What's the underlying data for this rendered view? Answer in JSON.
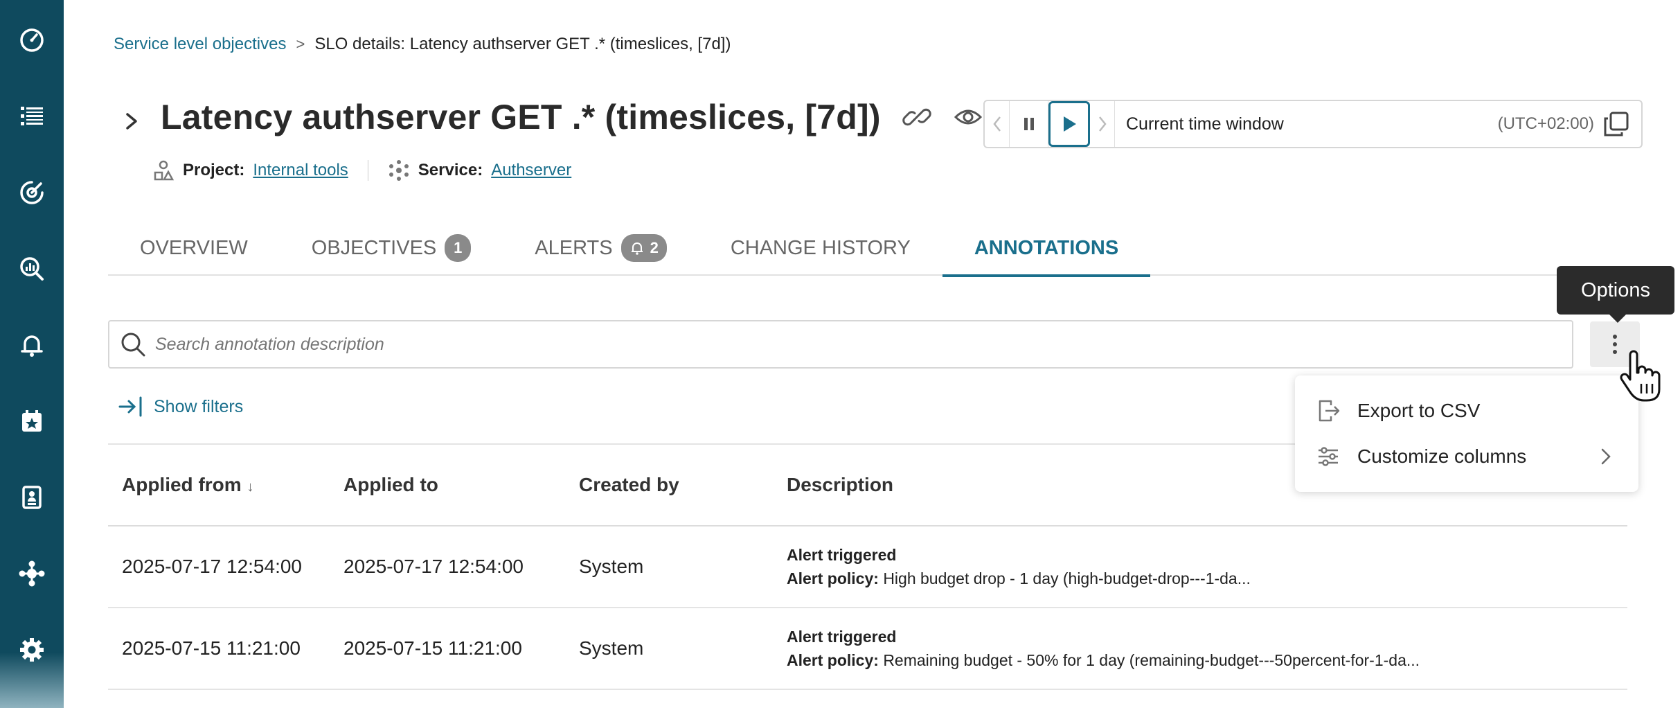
{
  "sidebar": {
    "icons": [
      "dashboard-icon",
      "list-icon",
      "slo-icon",
      "search-analytics-icon",
      "bell-icon",
      "calendar-star-icon",
      "report-icon",
      "integrations-icon",
      "settings-icon"
    ]
  },
  "breadcrumb": {
    "parent": "Service level objectives",
    "separator": ">",
    "current": "SLO details: Latency authserver GET .* (timeslices, [7d])"
  },
  "header": {
    "title": "Latency authserver GET .* (timeslices, [7d])",
    "project_label": "Project:",
    "project_value": "Internal tools",
    "service_label": "Service:",
    "service_value": "Authserver"
  },
  "time_control": {
    "label": "Current time window",
    "timezone": "(UTC+02:00)"
  },
  "tabs": [
    {
      "label": "OVERVIEW"
    },
    {
      "label": "OBJECTIVES",
      "badge": "1"
    },
    {
      "label": "ALERTS",
      "badge": "2"
    },
    {
      "label": "CHANGE HISTORY"
    },
    {
      "label": "ANNOTATIONS",
      "active": true
    }
  ],
  "search": {
    "placeholder": "Search annotation description"
  },
  "tooltip": {
    "text": "Options"
  },
  "filters": {
    "label": "Show filters"
  },
  "menu": {
    "items": [
      {
        "label": "Export to CSV",
        "icon": "export-icon"
      },
      {
        "label": "Customize columns",
        "icon": "sliders-icon"
      }
    ]
  },
  "table": {
    "columns": [
      "Applied from",
      "Applied to",
      "Created by",
      "Description"
    ],
    "sort_indicator": "↓",
    "rows": [
      {
        "applied_from": "2025-07-17 12:54:00",
        "applied_to": "2025-07-17 12:54:00",
        "created_by": "System",
        "desc_title": "Alert triggered",
        "desc_label": "Alert policy:",
        "desc_value": "High budget drop - 1 day (high-budget-drop---1-da..."
      },
      {
        "applied_from": "2025-07-15 11:21:00",
        "applied_to": "2025-07-15 11:21:00",
        "created_by": "System",
        "desc_title": "Alert triggered",
        "desc_label": "Alert policy:",
        "desc_value": "Remaining budget - 50% for 1 day (remaining-budget---50percent-for-1-da..."
      }
    ]
  },
  "colors": {
    "sidebar": "#0f4a5e",
    "accent": "#1a6f8c",
    "badge": "#8a8a8a"
  }
}
